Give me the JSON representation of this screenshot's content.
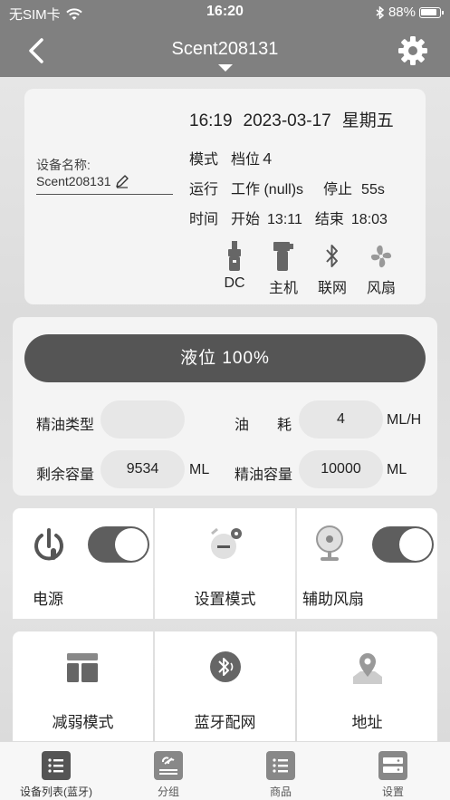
{
  "status_bar": {
    "carrier": "无SIM卡",
    "time": "16:20",
    "battery": "88%"
  },
  "nav": {
    "title": "Scent208131"
  },
  "device": {
    "name_label": "设备名称:",
    "name": "Scent208131",
    "time": "16:19",
    "date": "2023-03-17",
    "weekday": "星期五",
    "mode_label": "模式",
    "mode_value": "档位４",
    "run_label": "运行",
    "work_text": "工作 (null)s",
    "stop_text": "停止",
    "stop_value": "55s",
    "time_label": "时间",
    "start_label": "开始",
    "start_value": "13:11",
    "end_label": "结束",
    "end_value": "18:03",
    "indicators": [
      {
        "icon": "dc-plug-icon",
        "label": "DC"
      },
      {
        "icon": "host-icon",
        "label": "主机"
      },
      {
        "icon": "bluetooth-icon",
        "label": "联网"
      },
      {
        "icon": "fan-icon",
        "label": "风扇"
      }
    ]
  },
  "level": {
    "label": "液位 100%",
    "oil_type_label": "精油类型",
    "oil_type_value": "",
    "consumption_label_1": "油",
    "consumption_label_2": "耗",
    "consumption_value": "4",
    "consumption_unit": "ML/H",
    "remaining_label": "剩余容量",
    "remaining_value": "9534",
    "remaining_unit": "ML",
    "capacity_label": "精油容量",
    "capacity_value": "10000",
    "capacity_unit": "ML"
  },
  "tiles": {
    "power": {
      "label": "电源",
      "on": true
    },
    "set_mode": {
      "label": "设置模式"
    },
    "aux_fan": {
      "label": "辅助风扇",
      "on": true
    },
    "weaken_mode": {
      "label": "减弱模式"
    },
    "bt_network": {
      "label": "蓝牙配网"
    },
    "address": {
      "label": "地址"
    }
  },
  "tabs": [
    {
      "label": "设备列表(蓝牙)",
      "icon": "list-icon"
    },
    {
      "label": "分组",
      "icon": "link-icon"
    },
    {
      "label": "商品",
      "icon": "goods-list-icon"
    },
    {
      "label": "设置",
      "icon": "server-icon"
    }
  ],
  "colors": {
    "bar": "#808080",
    "accent": "#555555"
  }
}
